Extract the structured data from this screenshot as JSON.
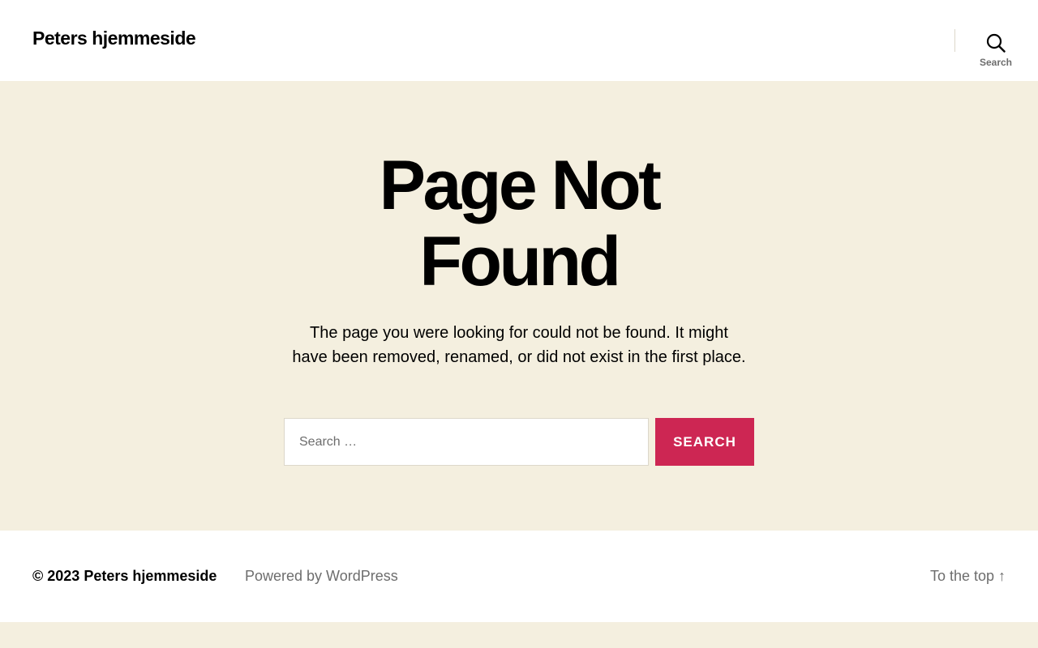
{
  "header": {
    "site_title": "Peters hjemmeside",
    "search_toggle_label": "Search",
    "search_icon": "search-icon"
  },
  "main": {
    "title_line1": "Page Not",
    "title_line2": "Found",
    "message": "The page you were looking for could not be found. It might have been removed, renamed, or did not exist in the first place.",
    "search": {
      "placeholder": "Search …",
      "value": "",
      "button_label": "Search"
    }
  },
  "footer": {
    "copyright_symbol": "© 2023",
    "copyright_name": "Peters hjemmeside",
    "powered_by": "Powered by WordPress",
    "to_top": "To the top ↑"
  },
  "colors": {
    "accent": "#cd2653",
    "background": "#f4efdf",
    "secondary_text": "#6d6d6d",
    "border": "#dcd7ca"
  }
}
